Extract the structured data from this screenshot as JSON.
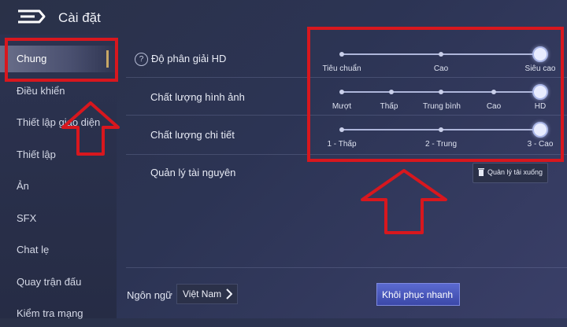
{
  "header": {
    "title": "Cài đặt",
    "back_icon": "back-arrow-icon"
  },
  "sidebar": {
    "items": [
      {
        "label": "Chung",
        "active": true
      },
      {
        "label": "Điều khiển"
      },
      {
        "label": "Thiết lập giao diện"
      },
      {
        "label": "Thiết lập"
      },
      {
        "label": "Ản"
      },
      {
        "label": "SFX"
      },
      {
        "label": "Chat lẹ"
      },
      {
        "label": "Quay trận đấu"
      },
      {
        "label": "Kiểm tra mạng"
      }
    ]
  },
  "settings": {
    "hd_resolution": {
      "label": "Độ phân giải HD",
      "help_icon": "?",
      "options": [
        "Tiêu chuẩn",
        "Cao",
        "Siêu cao"
      ],
      "selected": "Siêu cao"
    },
    "image_quality": {
      "label": "Chất lượng hình ảnh",
      "options": [
        "Mượt",
        "Thấp",
        "Trung bình",
        "Cao",
        "HD"
      ],
      "selected": "HD"
    },
    "detail_quality": {
      "label": "Chất lượng chi tiết",
      "options": [
        "1 - Thấp",
        "2 - Trung",
        "3 - Cao"
      ],
      "selected": "3 - Cao"
    },
    "resource_management": {
      "label": "Quản lý tài nguyên",
      "button_label": "Quản lý tải xuống"
    }
  },
  "footer": {
    "language_label": "Ngôn ngữ",
    "language_value": "Việt Nam",
    "restore_button": "Khôi phục nhanh"
  },
  "colors": {
    "annotation": "#d8171e",
    "accent": "#c7a766"
  }
}
